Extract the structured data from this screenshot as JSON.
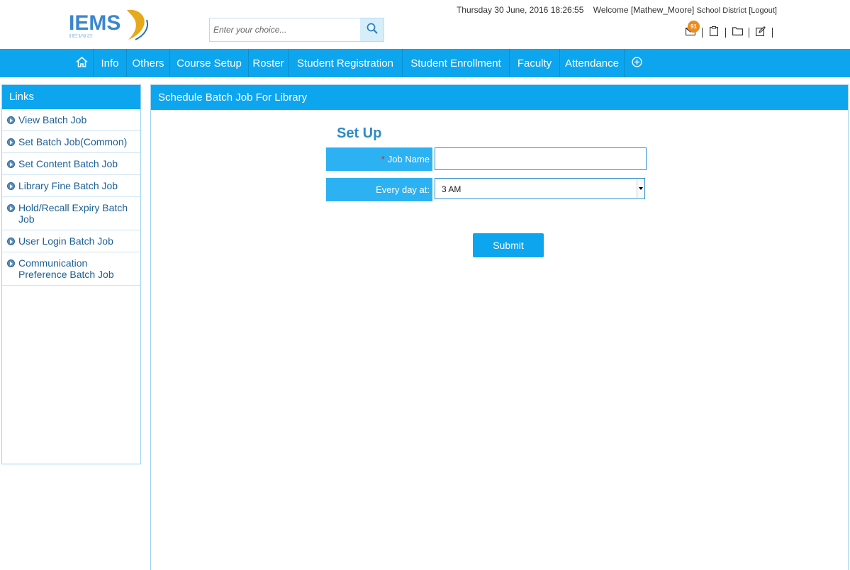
{
  "header": {
    "logo_text": "IEMS",
    "search": {
      "placeholder": "Enter your choice...",
      "value": ""
    },
    "datetime": "Thursday 30 June, 2016 18:26:55",
    "welcome": "Welcome [Mathew_Moore]",
    "district": "School District",
    "logout": "[Logout]",
    "mail_badge": "91",
    "icons": [
      "mail-icon",
      "clipboard-icon",
      "folder-icon",
      "edit-icon"
    ]
  },
  "nav": {
    "items": [
      "Info",
      "Others",
      "Course Setup",
      "Roster",
      "Student Registration",
      "Student Enrollment",
      "Faculty",
      "Attendance"
    ]
  },
  "sidebar": {
    "title": "Links",
    "items": [
      "View Batch Job",
      "Set Batch Job(Common)",
      "Set Content Batch Job",
      "Library Fine Batch Job",
      "Hold/Recall Expiry Batch Job",
      "User Login Batch Job",
      "Communication Preference Batch Job"
    ]
  },
  "main": {
    "title": "Schedule Batch Job For Library",
    "section_title": "Set Up",
    "job_name_label": "Job Name",
    "job_name_required": "*",
    "job_name_value": "",
    "every_day_label": "Every day at:",
    "every_day_value": "3 AM",
    "submit_label": "Submit"
  },
  "colors": {
    "primary": "#0ea5ef",
    "label_bg": "#2cb1f3",
    "badge": "#f0891c",
    "link": "#1b5f95",
    "title": "#2e8bc6"
  }
}
